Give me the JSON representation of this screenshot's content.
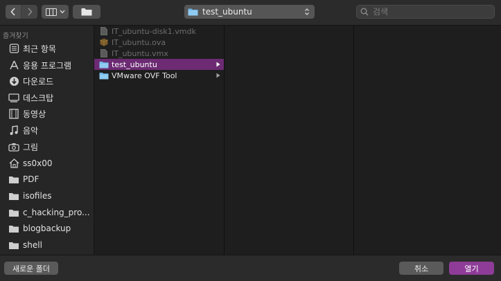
{
  "toolbar": {
    "path_label": "test_ubuntu",
    "search_placeholder": "검색"
  },
  "sidebar": {
    "heading": "즐겨찾기",
    "items": [
      {
        "label": "최근 항목",
        "icon": "recent-items-icon"
      },
      {
        "label": "응용 프로그램",
        "icon": "applications-icon"
      },
      {
        "label": "다운로드",
        "icon": "downloads-icon"
      },
      {
        "label": "데스크탑",
        "icon": "desktop-icon"
      },
      {
        "label": "동영상",
        "icon": "movies-icon"
      },
      {
        "label": "음악",
        "icon": "music-icon"
      },
      {
        "label": "그림",
        "icon": "pictures-icon"
      },
      {
        "label": "ss0x00",
        "icon": "home-icon"
      },
      {
        "label": "PDF",
        "icon": "folder-icon"
      },
      {
        "label": "isofiles",
        "icon": "folder-icon"
      },
      {
        "label": "c_hacking_pro...",
        "icon": "folder-icon"
      },
      {
        "label": "blogbackup",
        "icon": "folder-icon"
      },
      {
        "label": "shell",
        "icon": "folder-icon"
      }
    ]
  },
  "columns": {
    "col1": [
      {
        "label": "IT_ubuntu-disk1.vmdk",
        "icon": "document-icon",
        "state": "dim"
      },
      {
        "label": "IT_ubuntu.ova",
        "icon": "package-icon",
        "state": "dim"
      },
      {
        "label": "IT_ubuntu.vmx",
        "icon": "document-icon",
        "state": "dim"
      },
      {
        "label": "test_ubuntu",
        "icon": "folder-icon",
        "state": "selected"
      },
      {
        "label": "VMware OVF Tool",
        "icon": "folder-icon",
        "state": "normal"
      }
    ]
  },
  "footer": {
    "new_folder": "새로운 폴더",
    "cancel": "취소",
    "open": "열기"
  },
  "colors": {
    "accent": "#8e3c97",
    "selection": "#6c2b73",
    "folder": "#6fb8e8"
  }
}
